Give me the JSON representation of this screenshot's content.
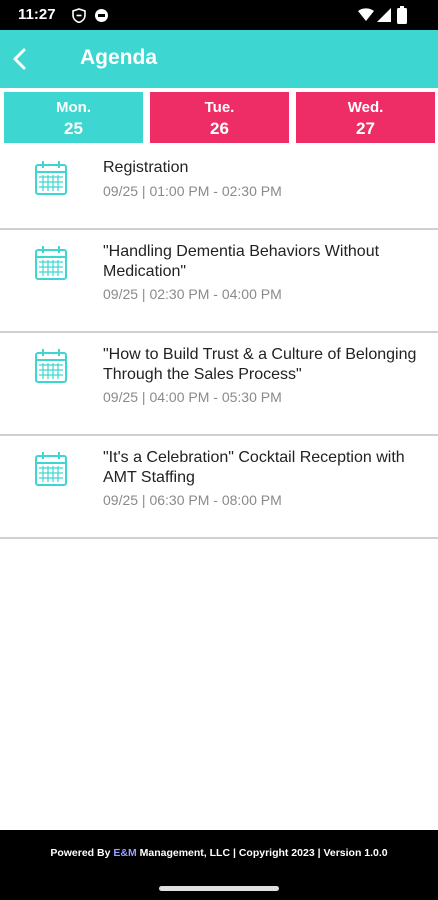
{
  "status": {
    "time": "11:27"
  },
  "appbar": {
    "title": "Agenda"
  },
  "days": [
    {
      "dow": "Mon.",
      "num": "25",
      "color": "#3dd6d0"
    },
    {
      "dow": "Tue.",
      "num": "26",
      "color": "#ee2d67"
    },
    {
      "dow": "Wed.",
      "num": "27",
      "color": "#ee2d67"
    }
  ],
  "sessions": [
    {
      "title": "Registration",
      "time": "09/25 | 01:00 PM - 02:30 PM"
    },
    {
      "title": "\"Handling Dementia Behaviors Without Medication\"",
      "time": "09/25 | 02:30 PM - 04:00 PM"
    },
    {
      "title": "\"How to Build Trust & a Culture of Belonging Through the Sales Process\"",
      "time": "09/25 | 04:00 PM - 05:30 PM"
    },
    {
      "title": "\"It's a Celebration\" Cocktail Reception with AMT Staffing",
      "time": "09/25 | 06:30 PM - 08:00 PM"
    }
  ],
  "footer": {
    "prefix": "Powered By ",
    "brand": "E&M",
    "suffix": " Management, LLC | Copyright 2023 | Version 1.0.0"
  },
  "colors": {
    "accent": "#3dd6d0",
    "inactive_day": "#ee2d67"
  }
}
